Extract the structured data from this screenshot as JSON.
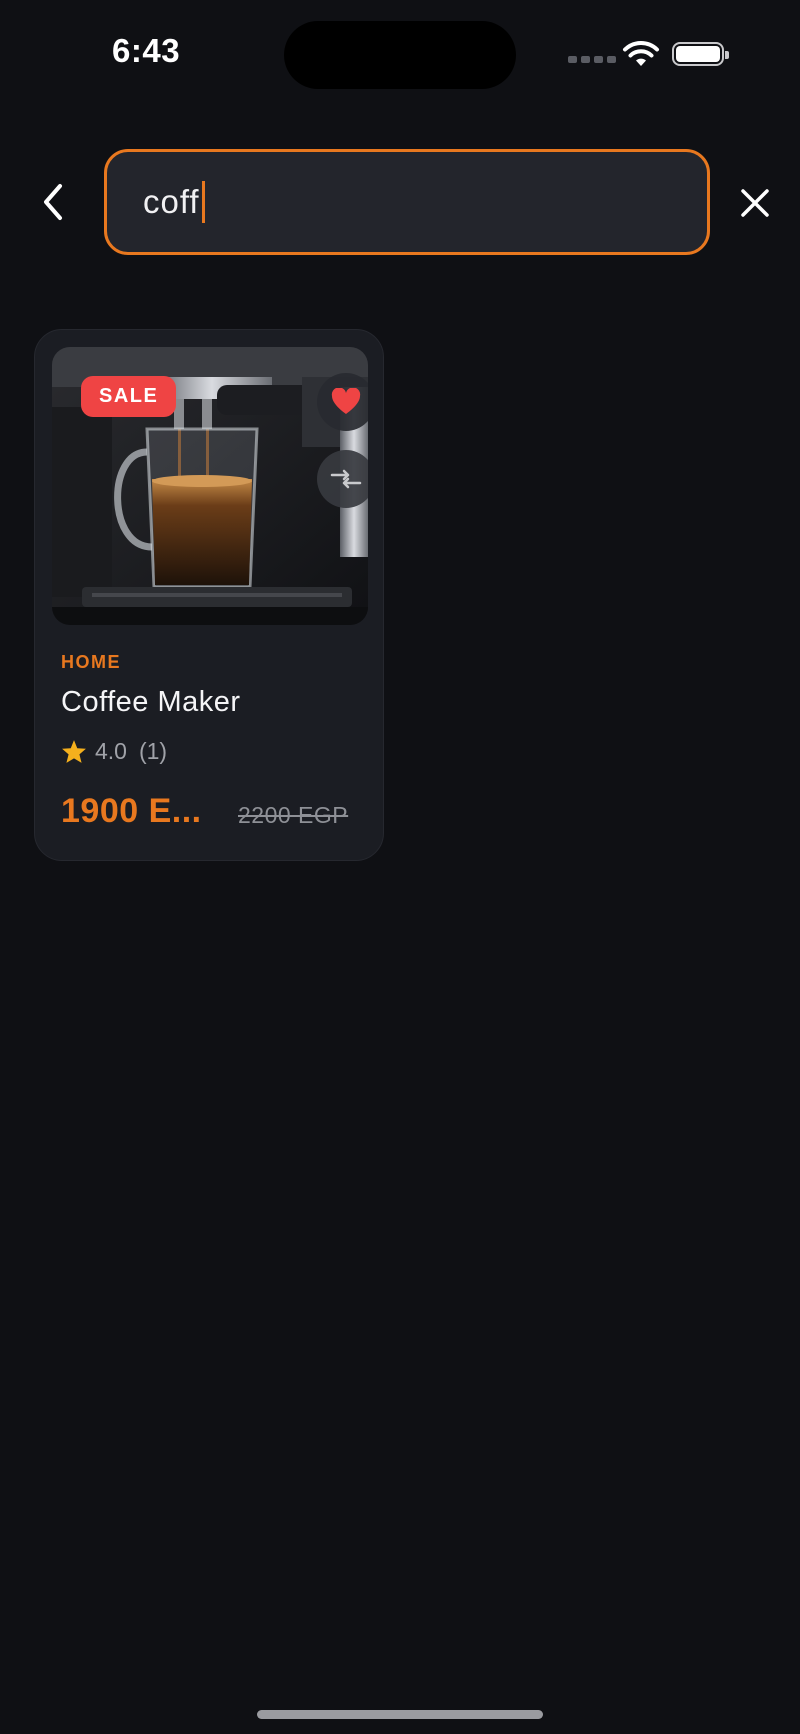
{
  "status_bar": {
    "time": "6:43",
    "icons": [
      "signal-icon",
      "wifi-icon",
      "battery-icon"
    ]
  },
  "search": {
    "value": "coff",
    "back_icon": "chevron-left-icon",
    "clear_icon": "close-icon",
    "accent_color": "#e8781f"
  },
  "results": [
    {
      "badge": "SALE",
      "category": "HOME",
      "name": "Coffee Maker",
      "rating": "4.0",
      "rating_count": "(1)",
      "price": "1900 E...",
      "old_price": "2200 EGP",
      "favorite_icon": "heart-icon",
      "compare_icon": "compare-arrows-icon",
      "rating_icon": "star-icon"
    }
  ],
  "colors": {
    "background": "#0f1014",
    "card": "#1b1d23",
    "accent": "#e8781f",
    "sale": "#ef4444",
    "favorite": "#ef4444",
    "star": "#f5b01d"
  }
}
